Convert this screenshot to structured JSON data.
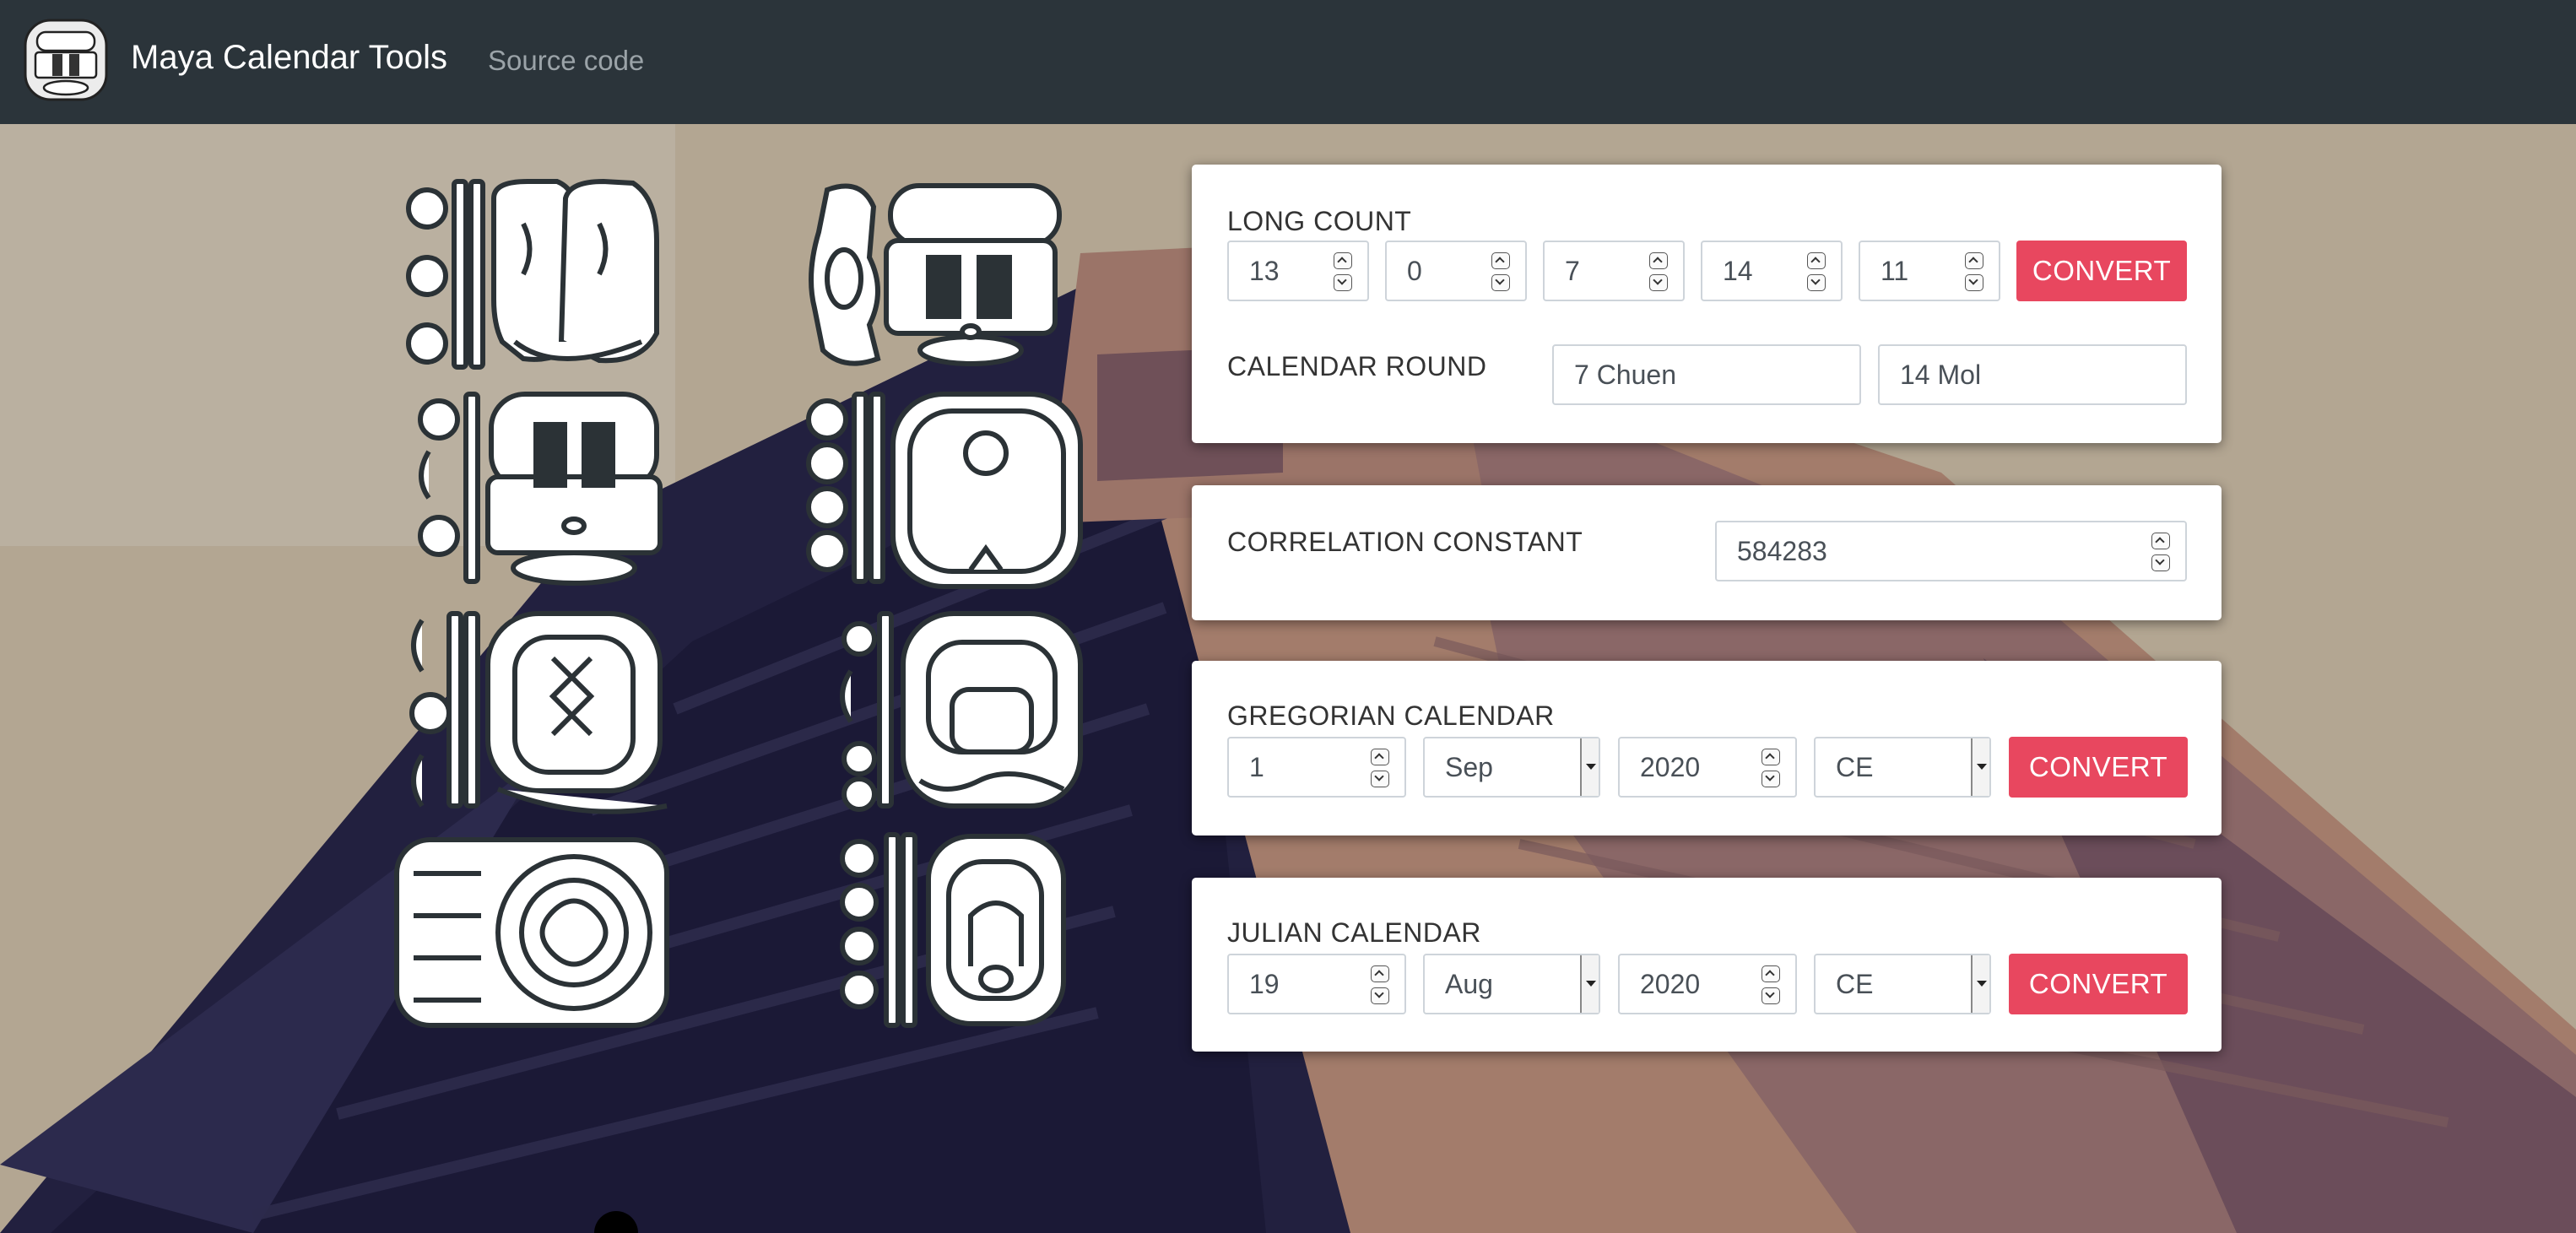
{
  "navbar": {
    "brand": "Maya Calendar Tools",
    "source_link": "Source code",
    "logo_icon": "maya-glyph-logo-icon",
    "background_color": "#2b343a"
  },
  "long_count": {
    "title": "LONG COUNT",
    "values": [
      "13",
      "0",
      "7",
      "14",
      "11"
    ],
    "convert_label": "CONVERT"
  },
  "calendar_round": {
    "title": "CALENDAR ROUND",
    "tzolkin": "7 Chuen",
    "haab": "14 Mol"
  },
  "correlation": {
    "title": "CORRELATION CONSTANT",
    "value": "584283"
  },
  "gregorian": {
    "title": "GREGORIAN CALENDAR",
    "day": "1",
    "month": "Sep",
    "year": "2020",
    "era": "CE",
    "convert_label": "CONVERT"
  },
  "julian": {
    "title": "JULIAN CALENDAR",
    "day": "19",
    "month": "Aug",
    "year": "2020",
    "era": "CE",
    "convert_label": "CONVERT"
  },
  "colors": {
    "accent": "#e8475f",
    "card_bg": "#ffffff"
  }
}
